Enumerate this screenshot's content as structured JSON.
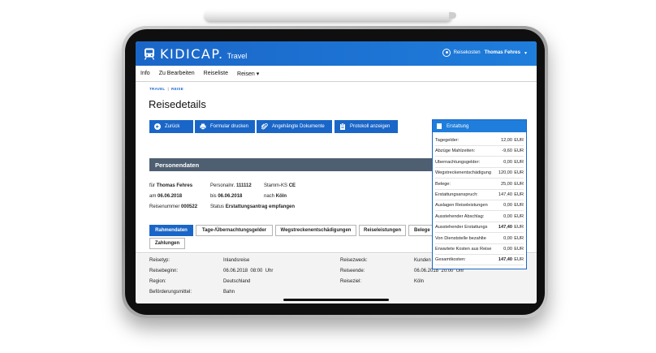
{
  "app": {
    "brand": "KIDICAP.",
    "product": "Travel"
  },
  "user": {
    "role": "Reisekosten",
    "name": "Thomas Fehres"
  },
  "nav": [
    "Info",
    "Zu Bearbeiten",
    "Reiseliste",
    "Reisen"
  ],
  "breadcrumb": [
    "TRAVEL",
    "REISE"
  ],
  "page_title": "Reisedetails",
  "toolbar": {
    "back": "Zurück",
    "print": "Formular drucken",
    "attachments": "Angehängte Dokumente",
    "log": "Protokoll anzeigen"
  },
  "person": {
    "section_title": "Personendaten",
    "fuer_label": "für",
    "fuer_value": "Thomas Fehres",
    "personalnr_label": "Personalnr.",
    "personalnr_value": "111112",
    "stammks_label": "Stamm-KS",
    "stammks_value": "CE",
    "am_label": "am",
    "am_value": "06.06.2018",
    "bis_label": "bis",
    "bis_value": "06.06.2018",
    "nach_label": "nach",
    "nach_value": "Köln",
    "reisenummer_label": "Reisenummer",
    "reisenummer_value": "000522",
    "status_label": "Status",
    "status_value": "Erstattungsantrag empfangen"
  },
  "tabs": [
    "Rahmendaten",
    "Tage-/Übernachtungsgelder",
    "Wegstreckenentschädigungen",
    "Reiseleistungen",
    "Belege",
    "Zahlungen"
  ],
  "details": {
    "reisetyp_label": "Reisetyp:",
    "reisetyp_value": "Inlandsreise",
    "reisebeginn_label": "Reisebeginn:",
    "reisebeginn_date": "06.06.2018",
    "reisebeginn_time": "08:00",
    "reisebeginn_unit": "Uhr",
    "region_label": "Region:",
    "region_value": "Deutschland",
    "befoerderung_label": "Beförderungsmittel:",
    "befoerderung_value": "Bahn",
    "reisezweck_label": "Reisezweck:",
    "reisezweck_value": "Kunden",
    "reiseende_label": "Reiseende:",
    "reiseende_date": "06.06.2018",
    "reiseende_time": "20:00",
    "reiseende_unit": "Uhr",
    "reiseziel_label": "Reiseziel:",
    "reiseziel_value": "Köln"
  },
  "erstattung": {
    "title": "Erstattung",
    "currency": "EUR",
    "rows": [
      {
        "label": "Tagegelder:",
        "value": "12,00"
      },
      {
        "label": "Abzüge Mahlzeiten:",
        "value": "-9,60"
      },
      {
        "label": "Übernachtungsgelder:",
        "value": "0,00"
      },
      {
        "label": "Wegstreckenentschädigung",
        "value": "120,00"
      },
      {
        "label": "Belege:",
        "value": "25,00"
      },
      {
        "label": "Erstattungsanspruch:",
        "value": "147,40"
      },
      {
        "label": "Auslagen Reiseleistungen",
        "value": "0,00"
      },
      {
        "label": "Ausstehender Abschlag:",
        "value": "0,00"
      },
      {
        "label": "Ausstehender Erstattungs",
        "value": "147,40",
        "bold": true
      },
      {
        "label": "Von Dienststelle bezahlte",
        "value": "0,00"
      },
      {
        "label": "Erwartete Kosten aus Reise",
        "value": "0,00"
      },
      {
        "label": "Gesamtkosten:",
        "value": "147,40",
        "bold": true
      }
    ]
  },
  "colors": {
    "brand_blue": "#1a66c8",
    "header_gray": "#4e5f71"
  }
}
